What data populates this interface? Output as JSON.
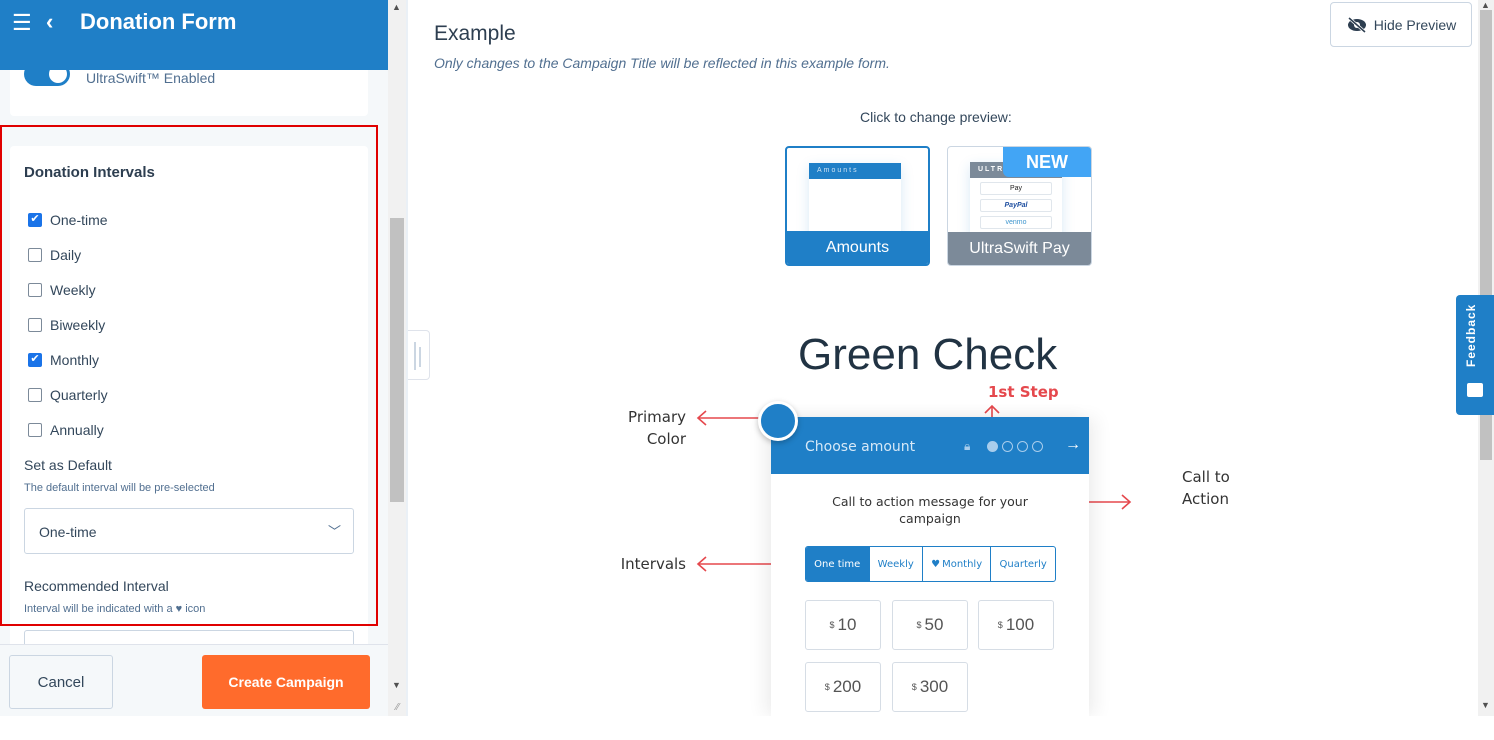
{
  "header": {
    "menu_icon": "☰",
    "back_icon": "‹",
    "title": "Donation Form"
  },
  "ultraswift": {
    "label": "UltraSwift™ Enabled",
    "enabled": true
  },
  "intervals_section": {
    "title": "Donation Intervals",
    "options": [
      {
        "label": "One-time",
        "checked": true
      },
      {
        "label": "Daily",
        "checked": false
      },
      {
        "label": "Weekly",
        "checked": false
      },
      {
        "label": "Biweekly",
        "checked": false
      },
      {
        "label": "Monthly",
        "checked": true
      },
      {
        "label": "Quarterly",
        "checked": false
      },
      {
        "label": "Annually",
        "checked": false
      }
    ],
    "default_label": "Set as Default",
    "default_help": "The default interval will be pre-selected",
    "default_value": "One-time",
    "recommended_label": "Recommended Interval",
    "recommended_help": "Interval will be indicated with a ♥ icon"
  },
  "footer": {
    "cancel_label": "Cancel",
    "create_label": "Create Campaign"
  },
  "preview": {
    "title": "Example",
    "subtitle": "Only changes to the Campaign Title will be reflected in this example form.",
    "hide_label": "Hide Preview",
    "click_label": "Click to change preview:",
    "thumbs": {
      "amounts": {
        "label": "Amounts",
        "mini_header": "Amounts"
      },
      "ultra": {
        "label": "UltraSwift Pay",
        "mini_header": "ULTRA",
        "badge": "NEW",
        "pills": [
          "Pay",
          "PayPal",
          "venmo"
        ]
      }
    },
    "campaign_title": "Green Check",
    "annotations": {
      "primary_color": [
        "Primary",
        "Color"
      ],
      "first_step": "1st Step",
      "call_to_action": [
        "Call to",
        "Action"
      ],
      "intervals": "Intervals"
    },
    "form": {
      "step_title": "Choose amount",
      "cta_message": "Call to action message for your campaign",
      "interval_buttons": [
        {
          "label": "One time",
          "active": true,
          "heart": false
        },
        {
          "label": "Weekly",
          "active": false,
          "heart": false
        },
        {
          "label": "Monthly",
          "active": false,
          "heart": true
        },
        {
          "label": "Quarterly",
          "active": false,
          "heart": false
        }
      ],
      "currency": "$",
      "amounts": [
        "10",
        "50",
        "100",
        "200",
        "300"
      ],
      "step_count": 4,
      "current_step": 1
    }
  },
  "feedback": {
    "label": "Feedback"
  },
  "colors": {
    "primary": "#1f7fc7",
    "cta_orange": "#ff6b2c",
    "annotation_red": "#e5484d",
    "highlight_red": "#e00000"
  }
}
